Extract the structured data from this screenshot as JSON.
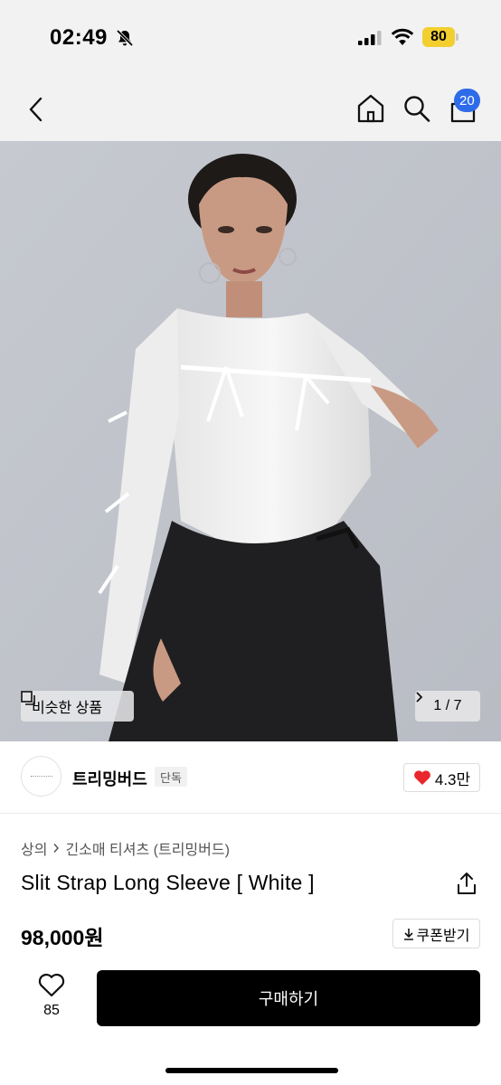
{
  "status_bar": {
    "time": "02:49",
    "battery": "80"
  },
  "header": {
    "cart_count": "20"
  },
  "gallery": {
    "similar_label": "비슷한 상품",
    "pager": "1 / 7"
  },
  "brand": {
    "name": "트리밍버드",
    "tag": "단독",
    "likes": "4.3만"
  },
  "product": {
    "breadcrumb": [
      "상의",
      "긴소매 티셔츠 (트리밍버드)"
    ],
    "title": "Slit Strap Long Sleeve [ White ]",
    "price": "98,000원",
    "coupon_label": "쿠폰받기"
  },
  "bottom_bar": {
    "wish_count": "85",
    "buy_label": "구매하기"
  },
  "icons": [
    "bell-slash-icon",
    "signal-icon",
    "wifi-icon",
    "battery-icon",
    "back-icon",
    "home-icon",
    "search-icon",
    "cart-icon",
    "similar-icon",
    "chevron-right-icon",
    "heart-icon",
    "share-icon",
    "download-icon"
  ],
  "colors": {
    "accent_badge": "#2d6be8",
    "battery": "#f2cf2e",
    "heart": "#e8262b",
    "buy_button": "#000000"
  }
}
